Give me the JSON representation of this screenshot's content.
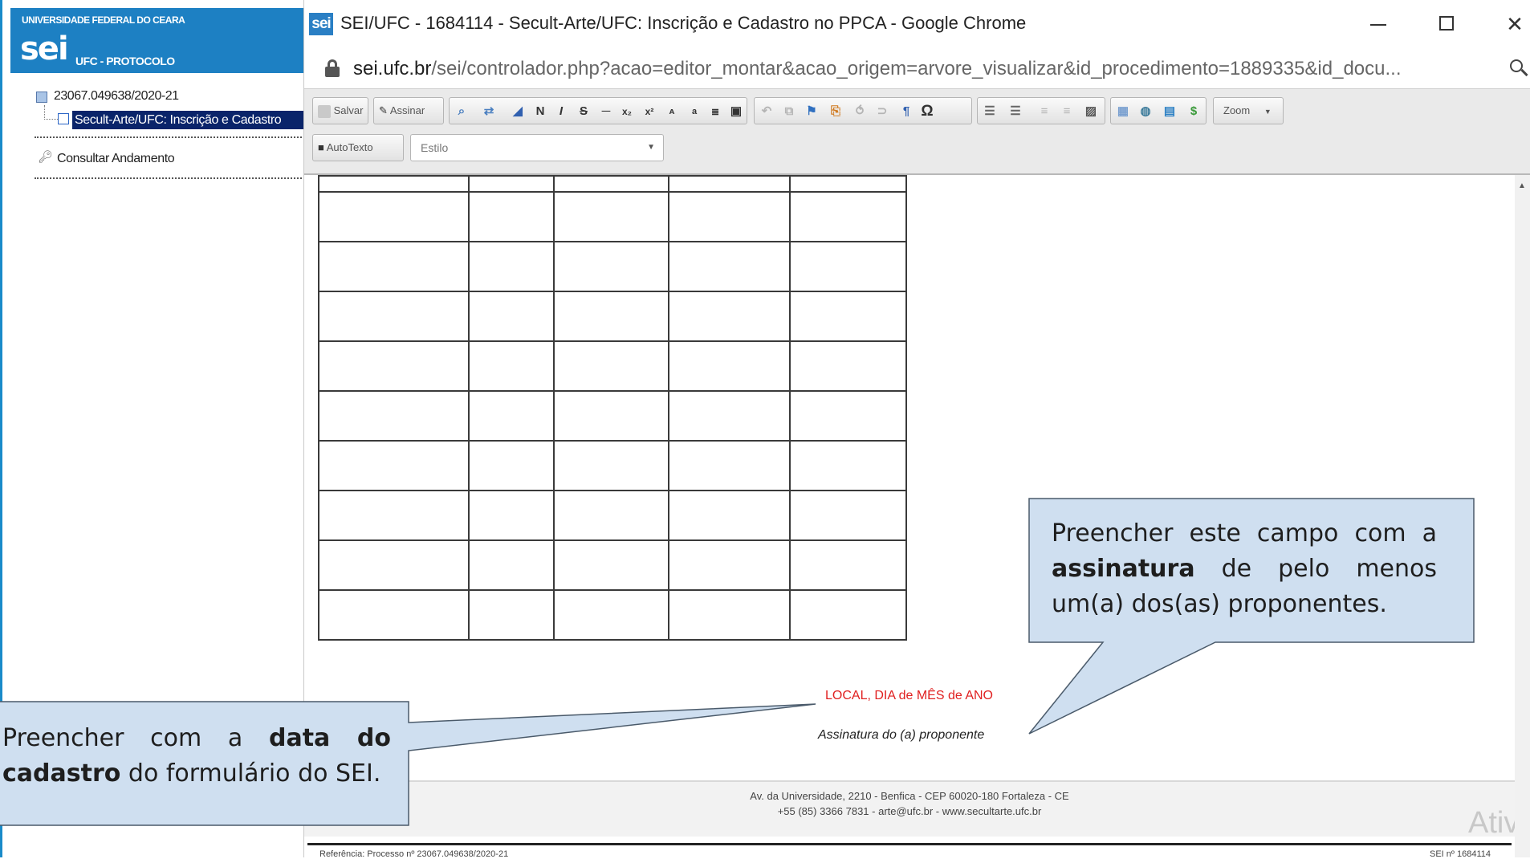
{
  "sei_panel": {
    "university": "UNIVERSIDADE FEDERAL DO CEARA",
    "logo_text": "sei",
    "protocolo_label": "UFC - PROTOCOLO",
    "process_number": "23067.049638/2020-21",
    "selected_document": "Secult-Arte/UFC: Inscrição e Cadastro",
    "consultar_label": "Consultar Andamento"
  },
  "chrome": {
    "favicon_text": "sei",
    "window_title": "SEI/UFC - 1684114 - Secult-Arte/UFC: Inscrição e Cadastro no PPCA - Google Chrome",
    "url_host": "sei.ufc.br",
    "url_path": "/sei/controlador.php?acao=editor_montar&acao_origem=arvore_visualizar&id_procedimento=1889335&id_docu..."
  },
  "toolbar": {
    "save_label": "Salvar",
    "sign_label": "Assinar",
    "autotexto_label": "AutoTexto",
    "estilo_placeholder": "Estilo",
    "zoom_label": "Zoom",
    "bold_glyph": "N",
    "italic_glyph": "I",
    "strike_glyph": "S",
    "omega_glyph": "Ω"
  },
  "document": {
    "local_date": "LOCAL, DIA de MÊS de ANO",
    "signature_line": "Assinatura do (a) proponente",
    "footer_line1": "Av. da Universidade, 2210 - Benfica - CEP 60020-180 Fortaleza - CE",
    "footer_line2": "+55 (85) 3366 7831 - arte@ufc.br - www.secultarte.ufc.br",
    "reference_left": "Referência: Processo nº 23067.049638/2020-21",
    "reference_right": "SEI nº 1684114",
    "watermark": "Ativ"
  },
  "callouts": {
    "right_pre": "Preencher este campo com a ",
    "right_bold": "assinatura",
    "right_post": " de pelo menos um(a) dos(as) proponentes.",
    "left_pre": "Preencher com a ",
    "left_bold": "data do cadastro",
    "left_post": " do formulário do SEI."
  },
  "colors": {
    "sei_blue": "#1d80c3",
    "selection_navy": "#0a246a",
    "callout_fill": "#cfdff0",
    "callout_border": "#4a5a6a",
    "date_red": "#e02020"
  }
}
